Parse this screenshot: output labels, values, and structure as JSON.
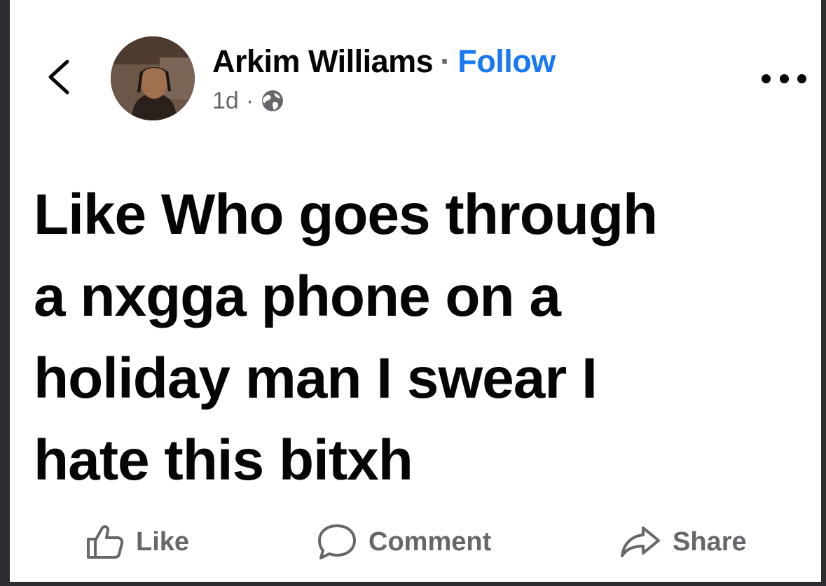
{
  "post": {
    "author": "Arkim Williams",
    "separator": "·",
    "follow_label": "Follow",
    "time": "1d",
    "meta_separator": "·",
    "privacy_icon": "globe-icon",
    "text": "Like Who goes through\na nxgga phone on a\nholiday man I swear I\nhate this bitxh"
  },
  "actions": {
    "like_label": "Like",
    "comment_label": "Comment",
    "share_label": "Share"
  },
  "icons": {
    "back": "chevron-left-icon",
    "more": "more-options-icon",
    "like": "thumbs-up-icon",
    "comment": "comment-bubble-icon",
    "share": "share-arrow-icon"
  },
  "colors": {
    "text": "#050505",
    "secondary": "#65676b",
    "link": "#1877f2"
  }
}
